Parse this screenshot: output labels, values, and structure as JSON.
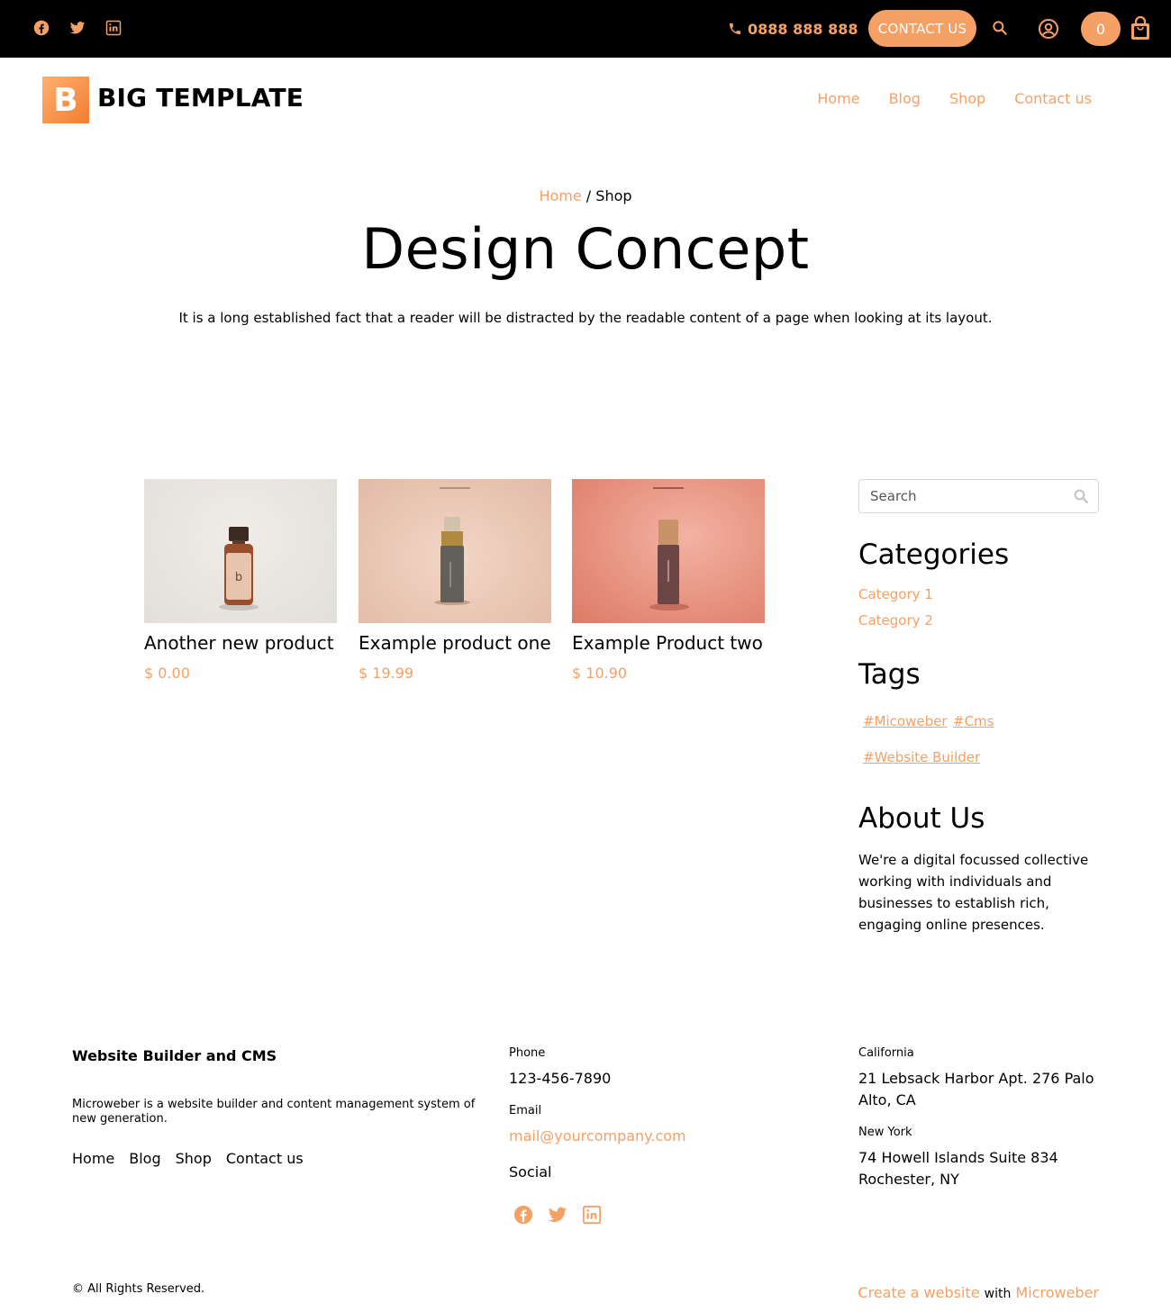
{
  "topbar": {
    "social_icons": [
      "facebook-icon",
      "twitter-icon",
      "linkedin-icon"
    ],
    "phone": "0888 888 888",
    "contact_label": "CONTACT US",
    "cart_count": "0"
  },
  "header": {
    "logo_letter": "B",
    "logo_text": "BIG TEMPLATE",
    "nav": [
      "Home",
      "Blog",
      "Shop",
      "Contact us"
    ]
  },
  "hero": {
    "breadcrumb_home": "Home",
    "breadcrumb_sep": "/",
    "breadcrumb_current": "Shop",
    "title": "Design Concept",
    "text": "It is a long established fact that a reader will be distracted by the readable content of a page when looking at its layout."
  },
  "products": [
    {
      "name": "Another new product",
      "price": "$ 0.00"
    },
    {
      "name": "Example product one",
      "price": "$ 19.99"
    },
    {
      "name": "Example Product two",
      "price": "$ 10.90"
    }
  ],
  "sidebar": {
    "search_placeholder": "Search",
    "categories_title": "Categories",
    "categories": [
      "Category 1",
      "Category 2"
    ],
    "tags_title": "Tags",
    "tags": [
      "#Micoweber",
      "#Cms",
      "#Website Builder"
    ],
    "about_title": "About Us",
    "about_text": "We're a digital focussed collective working with individuals and businesses to establish rich, engaging online presences."
  },
  "footer": {
    "title": "Website Builder and CMS",
    "description": "Microweber is a website builder and content management system of new generation.",
    "nav": [
      "Home",
      "Blog",
      "Shop",
      "Contact us"
    ],
    "phone_label": "Phone",
    "phone": "123-456-7890",
    "email_label": "Email",
    "email": "mail@yourcompany.com",
    "social_label": "Social",
    "social_icons": [
      "facebook-icon",
      "twitter-icon",
      "linkedin-icon"
    ],
    "california_label": "California",
    "california_address": "21 Lebsack Harbor Apt. 276 Palo Alto, CA",
    "newyork_label": "New York",
    "newyork_address": "74 Howell Islands Suite 834 Rochester, NY",
    "copyright": "© All Rights Reserved.",
    "credit_link": "Create a website",
    "credit_with": "with",
    "credit_brand": "Microweber"
  },
  "colors": {
    "accent": "#f5a064",
    "topbar": "#000000"
  }
}
